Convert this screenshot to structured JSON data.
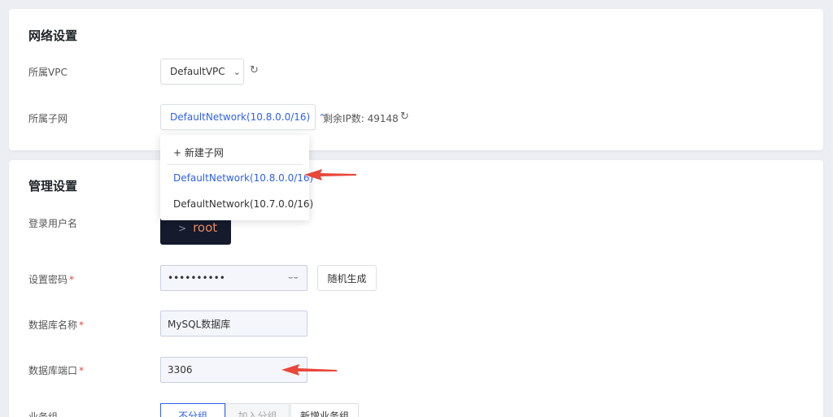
{
  "network": {
    "title": "网络设置",
    "vpc_label": "所属VPC",
    "vpc_value": "DefaultVPC",
    "subnet_label": "所属子网",
    "subnet_value": "DefaultNetwork(10.8.0.0/16)",
    "remaining_ip": "剩余IP数: 49148",
    "dropdown": {
      "new_subnet": "+ 新建子网",
      "options": [
        "DefaultNetwork(10.8.0.0/16)",
        "DefaultNetwork(10.7.0.0/16)"
      ],
      "selected_index": 0
    }
  },
  "management": {
    "title": "管理设置",
    "username_label": "登录用户名",
    "username_prompt": ">",
    "username_value": "root",
    "password_label": "设置密码",
    "password_value": "••••••••••",
    "random_button": "随机生成",
    "dbname_label": "数据库名称",
    "dbname_value": "MySQL数据库",
    "port_label": "数据库端口",
    "port_value": "3306",
    "group_label": "业务组",
    "group_options": [
      "不分组",
      "加入分组",
      "新增业务组"
    ],
    "required_mark": "*"
  },
  "icons": {
    "refresh": "refresh-icon",
    "chevron_down": "chevron-down-icon",
    "chevron_up": "chevron-up-icon",
    "eye_closed": "eye-closed-icon"
  },
  "colors": {
    "accent": "#2f61e8",
    "annotation_arrow": "#e8473b"
  }
}
